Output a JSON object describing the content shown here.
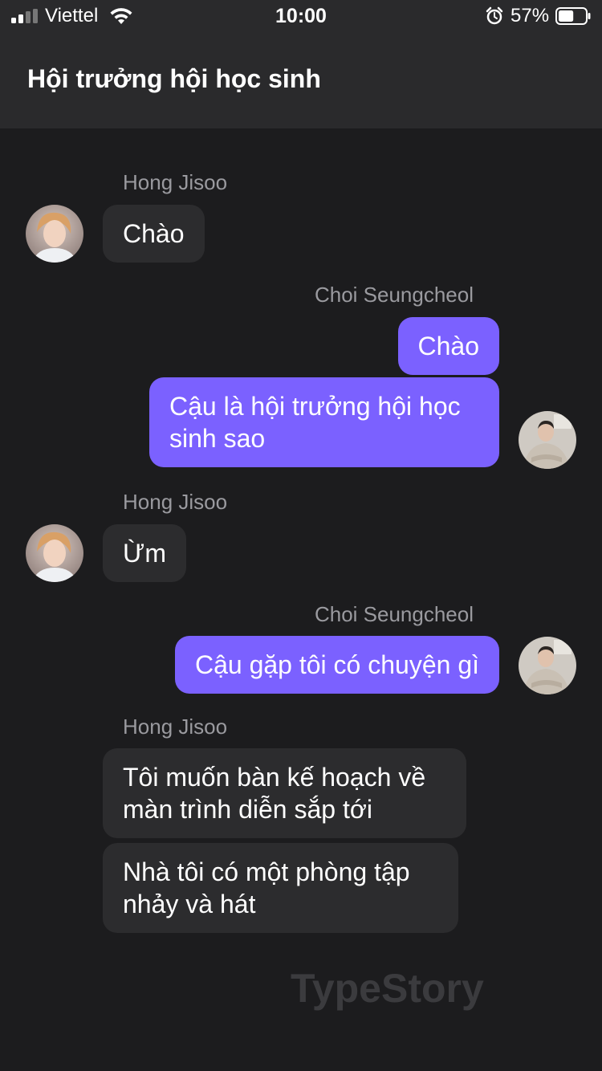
{
  "status_bar": {
    "carrier": "Viettel",
    "time": "10:00",
    "battery_percent": "57%",
    "battery_level": 0.57,
    "icons": [
      "signal-icon",
      "wifi-icon",
      "alarm-icon",
      "battery-icon"
    ]
  },
  "header": {
    "title": "Hội trưởng hội học sinh"
  },
  "colors": {
    "background": "#1c1c1e",
    "header": "#2a2a2c",
    "incoming_bubble": "#2c2c2e",
    "outgoing_bubble": "#7b61ff",
    "sender_name": "#9a9a9f"
  },
  "messages": [
    {
      "sender": "Hong Jisoo",
      "side": "left",
      "text": "Chào"
    },
    {
      "sender": "Choi Seungcheol",
      "side": "right",
      "text": "Chào"
    },
    {
      "sender": "Choi Seungcheol",
      "side": "right",
      "text": "Cậu là hội trưởng hội học sinh sao"
    },
    {
      "sender": "Hong Jisoo",
      "side": "left",
      "text": "Ừm"
    },
    {
      "sender": "Choi Seungcheol",
      "side": "right",
      "text": "Cậu gặp tôi có chuyện gì"
    },
    {
      "sender": "Hong Jisoo",
      "side": "left",
      "text": "Tôi muốn bàn kế hoạch về màn trình diễn sắp tới"
    },
    {
      "sender": "Hong Jisoo",
      "side": "left",
      "text": "Nhà tôi có một phòng tập nhảy và hát"
    }
  ],
  "watermark": "TypeStory"
}
